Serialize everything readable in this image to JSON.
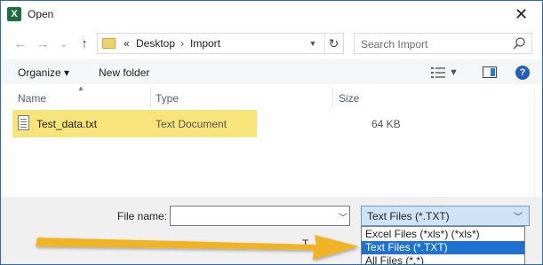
{
  "window": {
    "title": "Open",
    "app_icon_letter": "X",
    "close_glyph": "✕"
  },
  "nav": {
    "back": "←",
    "forward": "→",
    "recent": "⌄",
    "up": "↑",
    "refresh": "↻"
  },
  "address": {
    "overflow": "«",
    "crumbs": [
      "Desktop",
      "Import"
    ],
    "separator": "›"
  },
  "search": {
    "placeholder": "Search Import"
  },
  "toolbar": {
    "organize_label": "Organize ▾",
    "new_folder_label": "New folder",
    "help_label": "?"
  },
  "columns": [
    "Name",
    "Type",
    "Size"
  ],
  "files": [
    {
      "name": "Test_data.txt",
      "type": "Text Document",
      "size": "64 KB"
    }
  ],
  "bottom": {
    "file_name_label": "File name:",
    "file_name_value": "",
    "file_type_selected": "Text Files (*.TXT)",
    "file_type_options": [
      "Excel Files (*xls*) (*xls*)",
      "Text Files (*.TXT)",
      "All Files (*.*)"
    ],
    "obscured_label": "T"
  },
  "colors": {
    "highlight": "#f7e57c",
    "selection": "#1e73d2",
    "arrow": "#f0b323",
    "excel_green": "#1d6f42"
  }
}
